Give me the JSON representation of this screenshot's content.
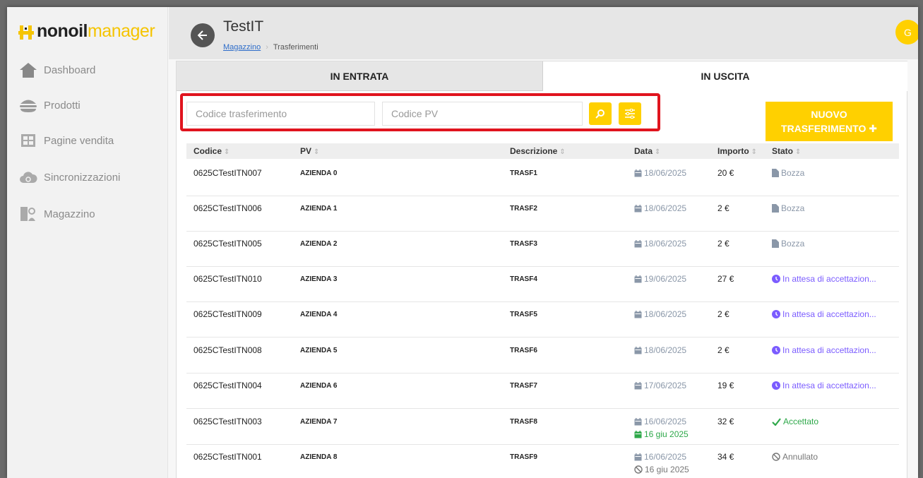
{
  "sidebar": {
    "logo_part1": "nonoil",
    "logo_part2": "manager",
    "items": [
      {
        "label": "Dashboard",
        "icon": "home-icon"
      },
      {
        "label": "Prodotti",
        "icon": "burger-icon"
      },
      {
        "label": "Pagine vendita",
        "icon": "storefront-icon"
      },
      {
        "label": "Sincronizzazioni",
        "icon": "cloud-sync-icon"
      },
      {
        "label": "Magazzino",
        "icon": "warehouse-icon"
      }
    ]
  },
  "header": {
    "title": "TestIT",
    "breadcrumb_link": "Magazzino",
    "breadcrumb_current": "Trasferimenti",
    "avatar_initial": "G"
  },
  "tabs": {
    "incoming": "IN ENTRATA",
    "outgoing": "IN USCITA"
  },
  "filters": {
    "code_placeholder": "Codice trasferimento",
    "pv_placeholder": "Codice PV"
  },
  "new_button": {
    "line1": "NUOVO",
    "line2": "TRASFERIMENTO ✚"
  },
  "columns": {
    "code": "Codice",
    "pv": "PV",
    "desc": "Descrizione",
    "date": "Data",
    "amount": "Importo",
    "status": "Stato"
  },
  "rows": [
    {
      "code": "0625CTestITN007",
      "pv": "AZIENDA 0",
      "desc": "TRASF1",
      "date": "18/06/2025",
      "date2": "",
      "amount": "20 €",
      "status": "Bozza",
      "status_type": "bozza"
    },
    {
      "code": "0625CTestITN006",
      "pv": "AZIENDA 1",
      "desc": "TRASF2",
      "date": "18/06/2025",
      "date2": "",
      "amount": "2 €",
      "status": "Bozza",
      "status_type": "bozza"
    },
    {
      "code": "0625CTestITN005",
      "pv": "AZIENDA 2",
      "desc": "TRASF3",
      "date": "18/06/2025",
      "date2": "",
      "amount": "2 €",
      "status": "Bozza",
      "status_type": "bozza"
    },
    {
      "code": "0625CTestITN010",
      "pv": "AZIENDA 3",
      "desc": "TRASF4",
      "date": "19/06/2025",
      "date2": "",
      "amount": "27 €",
      "status": "In attesa di accettazion...",
      "status_type": "wait"
    },
    {
      "code": "0625CTestITN009",
      "pv": "AZIENDA 4",
      "desc": "TRASF5",
      "date": "18/06/2025",
      "date2": "",
      "amount": "2 €",
      "status": "In attesa di accettazion...",
      "status_type": "wait"
    },
    {
      "code": "0625CTestITN008",
      "pv": "AZIENDA 5",
      "desc": "TRASF6",
      "date": "18/06/2025",
      "date2": "",
      "amount": "2 €",
      "status": "In attesa di accettazion...",
      "status_type": "wait"
    },
    {
      "code": "0625CTestITN004",
      "pv": "AZIENDA 6",
      "desc": "TRASF7",
      "date": "17/06/2025",
      "date2": "",
      "amount": "19 €",
      "status": "In attesa di accettazion...",
      "status_type": "wait"
    },
    {
      "code": "0625CTestITN003",
      "pv": "AZIENDA 7",
      "desc": "TRASF8",
      "date": "16/06/2025",
      "date2": "16 giu 2025",
      "date2_type": "ok",
      "amount": "32 €",
      "status": "Accettato",
      "status_type": "ok"
    },
    {
      "code": "0625CTestITN001",
      "pv": "AZIENDA 8",
      "desc": "TRASF9",
      "date": "16/06/2025",
      "date2": "16 giu 2025",
      "date2_type": "ann",
      "amount": "34 €",
      "status": "Annullato",
      "status_type": "ann"
    }
  ],
  "colors": {
    "accent": "#ffd000",
    "highlight": "#e0141e",
    "status_wait": "#7b5cff",
    "status_ok": "#2ea84a",
    "status_draft": "#8a97a8"
  }
}
